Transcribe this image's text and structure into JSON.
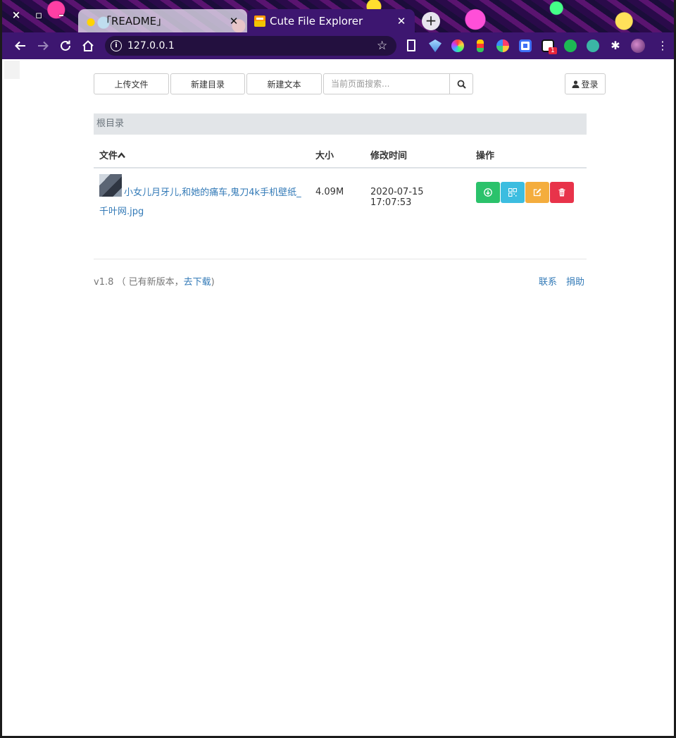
{
  "browser": {
    "tabs": [
      {
        "title": "「README」",
        "favicon": "readme-favicon-icon"
      },
      {
        "title": "Cute File Explorer",
        "favicon": "cute-explorer-favicon-icon"
      }
    ],
    "address": "127.0.0.1",
    "extension_badge": "1"
  },
  "toolbar": {
    "upload_label": "上传文件",
    "newdir_label": "新建目录",
    "newtext_label": "新建文本",
    "search_placeholder": "当前页面搜索...",
    "login_label": "登录"
  },
  "breadcrumb": "根目录",
  "table": {
    "headers": {
      "name": "文件",
      "size": "大小",
      "time": "修改时间",
      "ops": "操作"
    },
    "rows": [
      {
        "name": "小女儿月牙儿,和她的痛车,鬼刀4k手机壁纸_千叶网.jpg",
        "size": "4.09M",
        "time": "2020-07-15 17:07:53"
      }
    ]
  },
  "footer": {
    "version": "v1.8",
    "update_prefix": "（ 已有新版本，",
    "update_link": "去下载",
    "update_suffix": ")",
    "contact": "联系",
    "donate": "捐助"
  },
  "colors": {
    "download": "#2bc26b",
    "qr": "#3cbde0",
    "edit": "#f4ad3d",
    "delete": "#e8334a",
    "link": "#337ab7",
    "toolbar": "#3d1670"
  }
}
